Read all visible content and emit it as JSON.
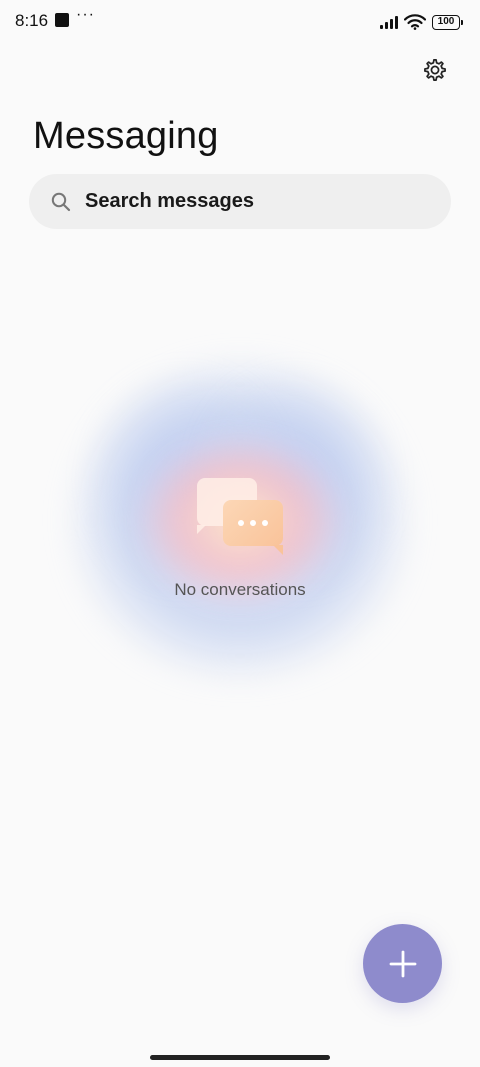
{
  "status_bar": {
    "time": "8:16",
    "overflow_indicator": "···",
    "battery_level": "100",
    "icons": [
      "signal-icon",
      "wifi-icon",
      "battery-icon"
    ]
  },
  "header": {
    "title": "Messaging",
    "settings_icon": "gear-icon"
  },
  "search": {
    "placeholder": "Search messages",
    "icon": "search-icon"
  },
  "empty_state": {
    "message": "No conversations",
    "icon": "chat-bubbles-icon"
  },
  "fab": {
    "icon": "plus-icon",
    "color": "#8e8bcc"
  },
  "colors": {
    "background": "#fafafa",
    "search_background": "#efefef",
    "accent": "#8e8bcc",
    "bubble": "#f9c39a"
  }
}
